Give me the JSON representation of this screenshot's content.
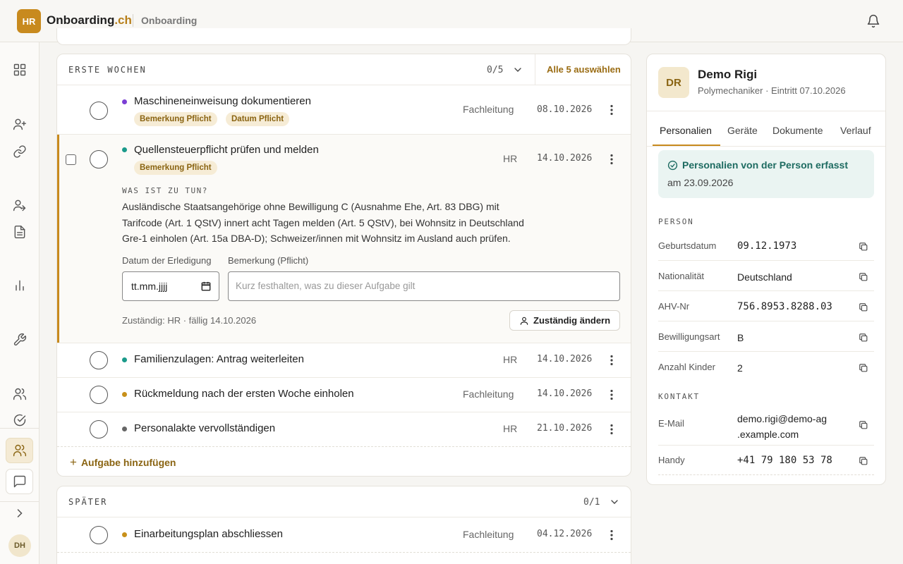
{
  "header": {
    "logo": "HR",
    "brand_main": "Onboarding",
    "brand_tld": ".ch",
    "breadcrumb": "Onboarding"
  },
  "sidebar": {
    "user_initials": "DH"
  },
  "section_first": {
    "title": "ERSTE WOCHEN",
    "count": "0/5",
    "select_all": "Alle 5 auswählen",
    "add_task": "Aufgabe hinzufügen",
    "tasks": [
      {
        "title": "Maschineneinweisung dokumentieren",
        "owner": "Fachleitung",
        "date": "08.10.2026",
        "dot_color": "#7b3fd4",
        "badges": [
          "Bemerkung Pflicht",
          "Datum Pflicht"
        ]
      },
      {
        "title": "Quellensteuerpflicht prüfen und melden",
        "owner": "HR",
        "date": "14.10.2026",
        "dot_color": "#1a9a8a",
        "badges": [
          "Bemerkung Pflicht"
        ],
        "details": {
          "heading": "WAS IST ZU TUN?",
          "text_lines": [
            "Ausländische Staatsangehörige ohne Bewilligung C (Ausnahme Ehe, Art. 83 DBG) mit",
            "Tarifcode (Art. 1 QStV) innert acht Tagen melden (Art. 5 QStV), bei Wohnsitz in Deutschland",
            "Gre-1 einholen (Art. 15a DBA-D); Schweizer/innen mit Wohnsitz im Ausland auch prüfen."
          ],
          "date_label": "Datum der Erledigung",
          "date_placeholder": "tt.mm.jjjj",
          "remark_label": "Bemerkung (Pflicht)",
          "remark_placeholder": "Kurz festhalten, was zu dieser Aufgabe gilt",
          "responsible_info": "Zuständig: HR · fällig 14.10.2026",
          "change_button": "Zuständig ändern"
        }
      },
      {
        "title": "Familienzulagen: Antrag weiterleiten",
        "owner": "HR",
        "date": "14.10.2026",
        "dot_color": "#1a9a8a"
      },
      {
        "title": "Rückmeldung nach der ersten Woche einholen",
        "owner": "Fachleitung",
        "date": "14.10.2026",
        "dot_color": "#c8901a"
      },
      {
        "title": "Personalakte vervollständigen",
        "owner": "HR",
        "date": "21.10.2026",
        "dot_color": "#666666"
      }
    ]
  },
  "section_later": {
    "title": "SPÄTER",
    "count": "0/1",
    "tasks": [
      {
        "title": "Einarbeitungsplan abschliessen",
        "owner": "Fachleitung",
        "date": "04.12.2026",
        "dot_color": "#c8901a"
      }
    ]
  },
  "person_panel": {
    "initials": "DR",
    "name": "Demo Rigi",
    "subtitle": "Polymechaniker · Eintritt 07.10.2026",
    "tabs": [
      "Personalien",
      "Geräte",
      "Dokumente",
      "Verlauf"
    ],
    "notice_title": "Personalien von der Person erfasst",
    "notice_date": "am 23.09.2026",
    "group_person": "PERSON",
    "person_fields": [
      {
        "label": "Geburtsdatum",
        "value": "09.12.1973"
      },
      {
        "label": "Nationalität",
        "value": "Deutschland"
      },
      {
        "label": "AHV-Nr",
        "value": "756.8953.8288.03"
      },
      {
        "label": "Bewilligungsart",
        "value": "B"
      },
      {
        "label": "Anzahl Kinder",
        "value": "2"
      }
    ],
    "group_contact": "KONTAKT",
    "contact_fields": [
      {
        "label": "E-Mail",
        "value_line1": "demo.rigi@demo-ag",
        "value_line2": ".example.com"
      },
      {
        "label": "Handy",
        "value": "+41 79 180 53 78"
      }
    ]
  }
}
